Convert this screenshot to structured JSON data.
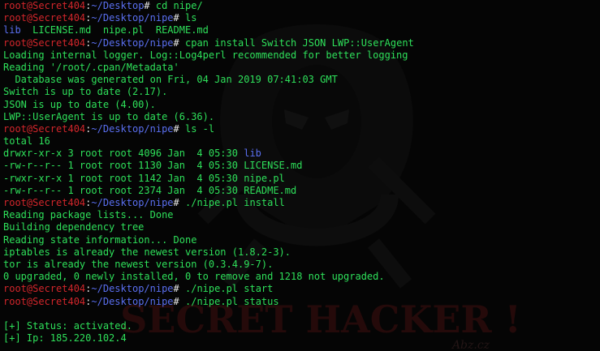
{
  "terminal": {
    "colors": {
      "background": "#050505",
      "text": "#2ee05a",
      "prompt_user": "#d2262b",
      "prompt_path": "#5a6ff0",
      "directory": "#5a6ff0"
    },
    "prompt_user": "root@Secret404",
    "prompt_sep": ":",
    "prompt_symbol": "#",
    "lines": [
      {
        "type": "prompt",
        "path": "~/Desktop",
        "cmd": " cd nipe/"
      },
      {
        "type": "prompt",
        "path": "~/Desktop/nipe",
        "cmd": " ls"
      },
      {
        "type": "ls",
        "dir": "lib",
        "rest": "  LICENSE.md  nipe.pl  README.md"
      },
      {
        "type": "prompt",
        "path": "~/Desktop/nipe",
        "cmd": " cpan install Switch JSON LWP::UserAgent"
      },
      {
        "type": "text",
        "text": "Loading internal logger. Log::Log4perl recommended for better logging"
      },
      {
        "type": "text",
        "text": "Reading '/root/.cpan/Metadata'"
      },
      {
        "type": "text",
        "text": "  Database was generated on Fri, 04 Jan 2019 07:41:03 GMT"
      },
      {
        "type": "text",
        "text": "Switch is up to date (2.17)."
      },
      {
        "type": "text",
        "text": "JSON is up to date (4.00)."
      },
      {
        "type": "text",
        "text": "LWP::UserAgent is up to date (6.36)."
      },
      {
        "type": "prompt",
        "path": "~/Desktop/nipe",
        "cmd": " ls -l"
      },
      {
        "type": "text",
        "text": "total 16"
      },
      {
        "type": "lsl",
        "text": "drwxr-xr-x 3 root root 4096 Jan  4 05:30 ",
        "dir": "lib"
      },
      {
        "type": "text",
        "text": "-rw-r--r-- 1 root root 1130 Jan  4 05:30 LICENSE.md"
      },
      {
        "type": "text",
        "text": "-rwxr-xr-x 1 root root 1142 Jan  4 05:30 nipe.pl"
      },
      {
        "type": "text",
        "text": "-rw-r--r-- 1 root root 2374 Jan  4 05:30 README.md"
      },
      {
        "type": "prompt",
        "path": "~/Desktop/nipe",
        "cmd": " ./nipe.pl install"
      },
      {
        "type": "text",
        "text": "Reading package lists... Done"
      },
      {
        "type": "text",
        "text": "Building dependency tree"
      },
      {
        "type": "text",
        "text": "Reading state information... Done"
      },
      {
        "type": "text",
        "text": "iptables is already the newest version (1.8.2-3)."
      },
      {
        "type": "text",
        "text": "tor is already the newest version (0.3.4.9-7)."
      },
      {
        "type": "text",
        "text": "0 upgraded, 0 newly installed, 0 to remove and 1218 not upgraded."
      },
      {
        "type": "prompt",
        "path": "~/Desktop/nipe",
        "cmd": " ./nipe.pl start"
      },
      {
        "type": "prompt",
        "path": "~/Desktop/nipe",
        "cmd": " ./nipe.pl status"
      },
      {
        "type": "blank"
      },
      {
        "type": "status",
        "text": " Status: activated."
      },
      {
        "type": "status",
        "text": " Ip: 185.220.102.4"
      }
    ],
    "status_marker": "[+]"
  },
  "wallpaper": {
    "banner_text": "SECRET HACKER !",
    "signature_text": "Abz.cz"
  }
}
